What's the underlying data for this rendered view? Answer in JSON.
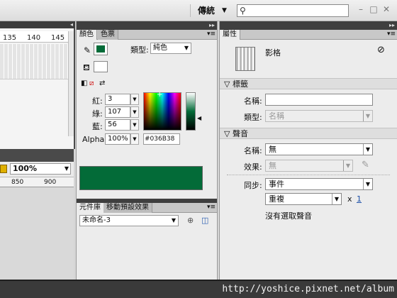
{
  "titlebar": {
    "workspace_label": "傳統",
    "search_placeholder": ""
  },
  "timeline": {
    "frame_numbers": [
      "135",
      "140",
      "145"
    ]
  },
  "stage": {
    "zoom": "100%",
    "ruler_marks": [
      "850",
      "900"
    ]
  },
  "color_panel": {
    "tabs": [
      {
        "label": "顏色"
      },
      {
        "label": "色票"
      }
    ],
    "type_label": "類型:",
    "type_value": "純色",
    "red_label": "紅:",
    "red_value": "3",
    "green_label": "綠:",
    "green_value": "107",
    "blue_label": "藍:",
    "blue_value": "56",
    "alpha_label": "Alpha:",
    "alpha_value": "100%",
    "hex_value": "#036B38",
    "stroke_color": "#036B38",
    "fill_color": "#ffffff",
    "preview_color": "#036B38"
  },
  "library_panel": {
    "tabs": [
      {
        "label": "元件庫"
      },
      {
        "label": "移動預設效果"
      }
    ],
    "document_select": "未命名-3"
  },
  "properties_panel": {
    "tab_label": "屬性",
    "object_type": "影格",
    "label_section": "標籤",
    "name_label": "名稱:",
    "name_value": "",
    "type_label": "類型:",
    "type_value": "名稱",
    "sound_section": "聲音",
    "sound_name_label": "名稱:",
    "sound_name_value": "無",
    "effect_label": "效果:",
    "effect_value": "無",
    "sync_label": "同步:",
    "sync_value": "事件",
    "repeat_value": "重複",
    "repeat_times_x": "x",
    "repeat_count": "1",
    "no_sound_text": "沒有選取聲音"
  },
  "watermark": "http://yoshice.pixnet.net/album"
}
